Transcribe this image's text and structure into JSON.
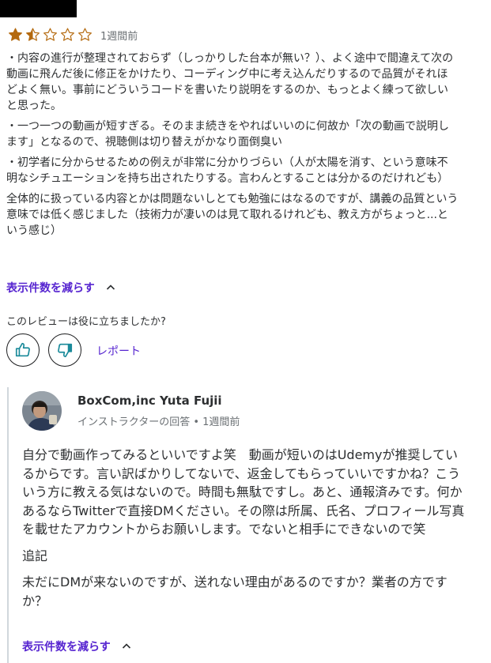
{
  "review": {
    "rating": 1.5,
    "max_rating": 5,
    "date": "1週間前",
    "paragraphs": [
      "・内容の進行が整理されておらず（しっかりした台本が無い？）、よく途中で間違えて次の動画に飛んだ後に修正をかけたり、コーディング中に考え込んだりするので品質がそれほどよく無い。事前にどういうコードを書いたり説明をするのか、もっとよく練って欲しいと思った。",
      "・一つ一つの動画が短すぎる。そのまま続きをやればいいのに何故か「次の動画で説明します」となるので、視聴側は切り替えがかなり面倒臭い",
      "・初学者に分からせるための例えが非常に分かりづらい（人が太陽を消す、という意味不明なシチュエーションを持ち出されたりする。言わんとすることは分かるのだけれども）",
      "全体的に扱っている内容とかは問題ないしとても勉強にはなるのですが、講義の品質という意味では低く感じました（技術力が凄いのは見て取れるけれども、教え方がちょっと...という感じ）"
    ],
    "show_less_label": "表示件数を減らす",
    "helpful_question": "このレビューは役に立ちましたか?",
    "report_label": "レポート"
  },
  "instructor_response": {
    "name": "BoxCom,inc Yuta Fujii",
    "meta": "インストラクターの回答 • 1週間前",
    "paragraphs": [
      "自分で動画作ってみるといいですよ笑　動画が短いのはUdemyが推奨しているからです。言い訳ばかりしてないで、返金してもらっていいですかね？こういう方に教える気はないので。時間も無駄ですし。あと、通報済みです。何かあるならTwitterで直接DMください。その際は所属、氏名、プロフィール写真を載せたアカウントからお願いします。でないと相手にできないので笑",
      "追記",
      "未だにDMが来ないのですが、送れない理由があるのですか？業者の方ですか？"
    ],
    "show_less_label": "表示件数を減らす"
  },
  "colors": {
    "star": "#b4690e",
    "link": "#5624d0",
    "icon_teal": "#1a8a9a",
    "text": "#2d2f31",
    "muted": "#6a6f73"
  },
  "icons": [
    "star-full-icon",
    "star-half-icon",
    "star-empty-icon",
    "chevron-up-icon",
    "thumbs-up-icon",
    "thumbs-down-icon",
    "avatar-photo"
  ]
}
